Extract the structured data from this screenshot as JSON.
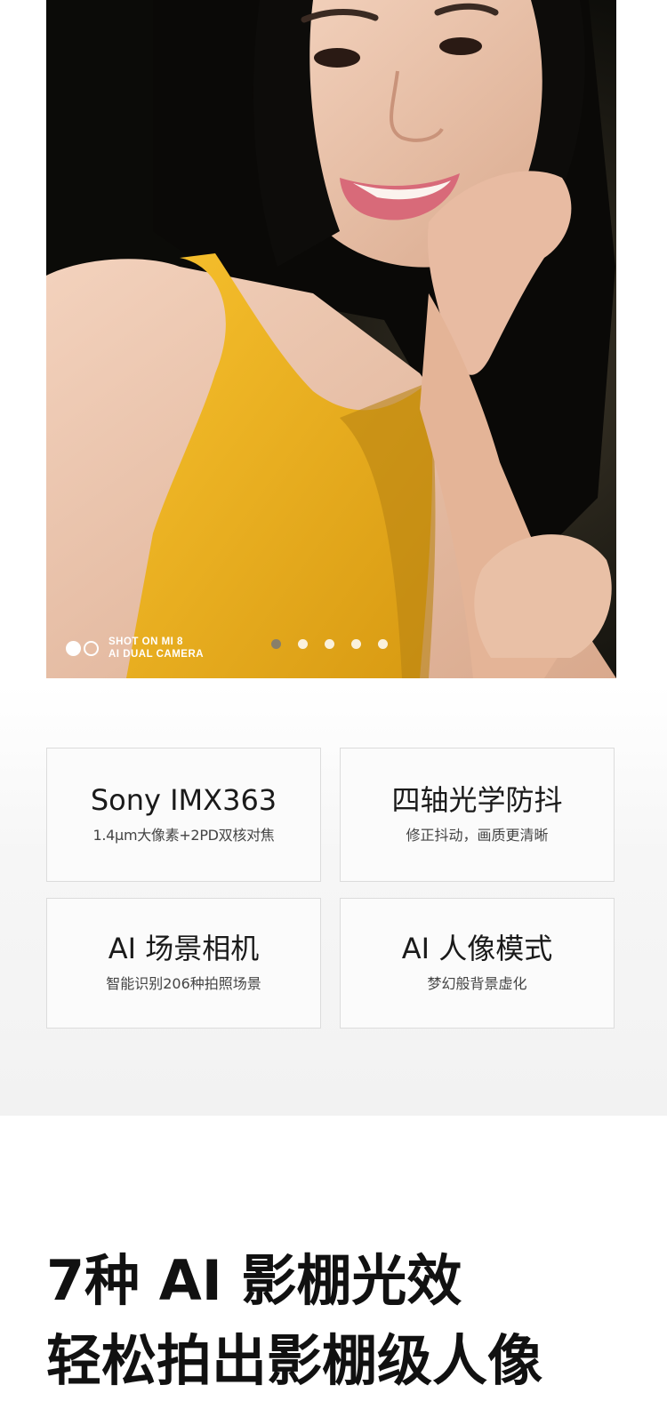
{
  "hero": {
    "watermark_line1": "SHOT ON MI 8",
    "watermark_line2": "AI DUAL CAMERA",
    "watermark_icon": "dual-camera-icon",
    "carousel": {
      "total": 5,
      "active_index": 1
    }
  },
  "features": [
    {
      "title": "Sony IMX363",
      "subtitle": "1.4μm大像素+2PD双核对焦"
    },
    {
      "title": "四轴光学防抖",
      "subtitle": "修正抖动，画质更清晰"
    },
    {
      "title": "AI 场景相机",
      "subtitle": "智能识别206种拍照场景"
    },
    {
      "title": "AI 人像模式",
      "subtitle": "梦幻般背景虚化"
    }
  ],
  "headline": {
    "line1": "7种 AI 影棚光效",
    "line2": "轻松拍出影棚级人像"
  },
  "colors": {
    "top_color": "#f2b227",
    "background_light": "#f4f4f4",
    "card_border": "#dcdcdc"
  }
}
